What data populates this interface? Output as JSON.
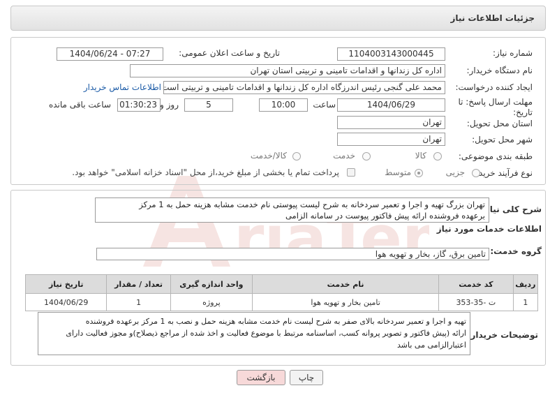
{
  "header": {
    "title": "جزئیات اطلاعات نیاز"
  },
  "fields": {
    "need_number_label": "شماره نیاز:",
    "need_number": "1104003143000445",
    "announce_label": "تاریخ و ساعت اعلان عمومی:",
    "announce_value": "1404/06/24 - 07:27",
    "buyer_org_label": "نام دستگاه خریدار:",
    "buyer_org": "اداره کل زندانها و اقدامات تامینی و تربیتی استان تهران",
    "creator_label": "ایجاد کننده درخواست:",
    "creator": "محمد علی گنجی رئیس اندرزگاه  اداره کل زندانها و اقدامات تامینی و تربیتی است",
    "contact_link": "اطلاعات تماس خریدار",
    "deadline_label_1": "مهلت ارسال پاسخ: تا",
    "deadline_label_2": "تاریخ:",
    "deadline_date": "1404/06/29",
    "time_label": "ساعت",
    "deadline_time": "10:00",
    "days_value": "5",
    "days_label": "روز و",
    "remaining_time": "01:30:23",
    "remaining_label": "ساعت باقی مانده",
    "province_label": "استان محل تحویل:",
    "province": "تهران",
    "city_label": "شهر محل تحویل:",
    "city": "تهران",
    "category_label": "طبقه بندی موضوعی:",
    "category_options": [
      "کالا",
      "خدمت",
      "کالا/خدمت"
    ],
    "process_label": "نوع فرآیند خرید :",
    "process_options": [
      "جزیی",
      "متوسط"
    ],
    "payment_note": "پرداخت تمام یا بخشی از مبلغ خرید،از محل \"اسناد خزانه اسلامی\" خواهد بود."
  },
  "summary": {
    "label": "شرح کلی نیاز:",
    "text_line1": "تهران بزرگ تهیه و اجرا و تعمیر سردخانه به شرح لیست پیوستی نام خدمت مشابه هزینه حمل به 1 مرکز",
    "text_line2": "برعهده فروشنده ارائه پیش فاکتور  پیوست در سامانه الزامی"
  },
  "services": {
    "section_title": "اطلاعات خدمات مورد نیاز",
    "group_label": "گروه خدمت:",
    "group_value": "تامین برق، گاز، بخار و تهویه هوا",
    "columns": [
      "ردیف",
      "کد خدمت",
      "نام خدمت",
      "واحد اندازه گیری",
      "تعداد / مقدار",
      "تاریخ نیاز"
    ],
    "rows": [
      [
        "1",
        "ت -35-353",
        "تامین بخار و تهویه هوا",
        "پروژه",
        "1",
        "1404/06/29"
      ]
    ]
  },
  "buyer_notes": {
    "label": "توضیحات خریدار:",
    "line1": "تهیه و اجرا و تعمیر سردخانه بالای صفر به شرح لیست نام خدمت مشابه هزینه حمل و نصب به 1 مرکز برعهده فروشنده",
    "line2": "ارائه (پیش فاکتور و  تصویر پروانه کسب، اساسنامه مرتبط با موضوع فعالیت و اخذ شده از مراجع ذیصلاح)و مجوز فعالیت دارای",
    "line3": "اعتبارالزامی می باشد"
  },
  "buttons": {
    "print": "چاپ",
    "back": "بازگشت"
  },
  "colors": {
    "back_button_bg": "#f7d9d9",
    "print_button_bg": "#f3f3f3",
    "link": "#1a5aa6",
    "watermark": "#c0392b"
  }
}
